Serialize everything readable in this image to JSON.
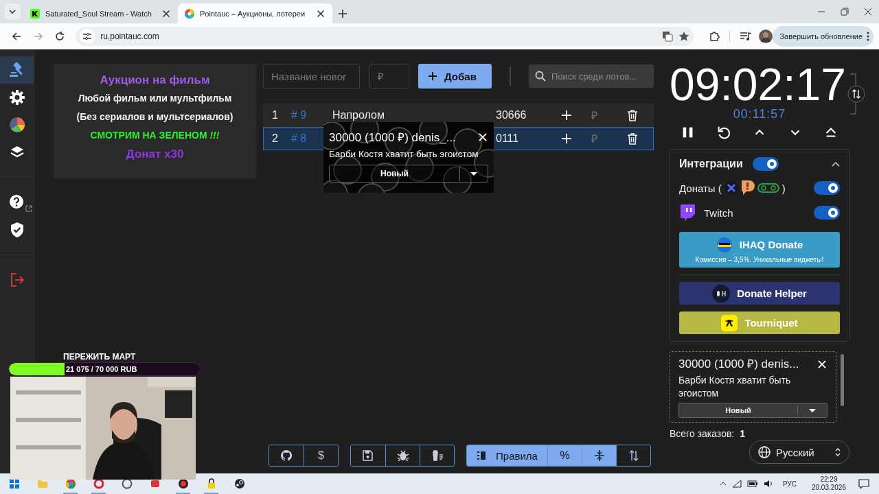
{
  "browser": {
    "tabs": [
      {
        "title": "Saturated_Soul Stream - Watch",
        "selected": false
      },
      {
        "title": "Pointauc – Аукционы, лотереи",
        "selected": true
      }
    ],
    "url": "ru.pointauc.com",
    "update_button": "Завершить обновление"
  },
  "sidebar": {
    "groups": [
      [
        {
          "kind": "auction",
          "selected": true
        },
        {
          "kind": "settings",
          "selected": false
        },
        {
          "kind": "statistics",
          "selected": false
        },
        {
          "kind": "layers",
          "selected": false
        }
      ],
      [
        {
          "kind": "help",
          "selected": false
        },
        {
          "kind": "security",
          "selected": false
        }
      ],
      [
        {
          "kind": "logout",
          "selected": false
        }
      ]
    ]
  },
  "rules": [
    {
      "text": "Аукцион на фильм",
      "kind": "title"
    },
    {
      "text": "Любой фильм или мультфильм",
      "kind": "text"
    },
    {
      "text": "(Без сериалов и мультсериалов)",
      "kind": "text"
    },
    {
      "text": "СМОТРИМ НА ЗЕЛЕНОМ *!!!*",
      "kind": "alert"
    },
    {
      "text": "Донат x30",
      "kind": "accent"
    }
  ],
  "new_lot": {
    "name_placeholder": "Название новог",
    "amount_placeholder": "₽",
    "add_button": "Добав"
  },
  "search": {
    "placeholder": "Поиск среди лотов..."
  },
  "lots": [
    {
      "index": "1",
      "id": "# 9",
      "name": "Напролом",
      "amount": "30666",
      "currency": "₽",
      "selected": false
    },
    {
      "index": "2",
      "id": "# 8",
      "amount": "0111",
      "currency": "₽",
      "selected": true
    }
  ],
  "dragged_donation": {
    "title": "30000 (1000 ₽) denis_...",
    "message": "Барби Костя хватит быть эгоистом",
    "status": "Новый"
  },
  "toolbar": {
    "groups": [
      [
        {
          "kind": "github",
          "selected": false
        },
        {
          "kind": "text",
          "label": "$",
          "selected": false
        }
      ],
      [
        {
          "kind": "save",
          "selected": false
        },
        {
          "kind": "bug",
          "selected": false
        },
        {
          "kind": "clear",
          "selected": false
        }
      ],
      [
        {
          "kind": "rules",
          "label": "Правила",
          "selected": true
        },
        {
          "kind": "text",
          "label": "%",
          "selected": true
        },
        {
          "kind": "compress",
          "selected": true
        },
        {
          "kind": "sort",
          "selected": false
        }
      ]
    ]
  },
  "timer": {
    "time": "09:02:17",
    "elapsed": "00:11:57"
  },
  "integrations": {
    "title": "Интеграции",
    "on": true,
    "expanded": true,
    "donations": {
      "label": "Донаты (",
      "suffix": ")",
      "on": true
    },
    "twitch": {
      "label": "Twitch",
      "on": true
    },
    "services": [
      {
        "kind": "ihaq",
        "name": "IHAQ Donate",
        "subtitle": "Комиссия – 3,5%. Уникальные виджеты!"
      },
      {
        "kind": "donatehelper",
        "name": "Donate Helper"
      },
      {
        "kind": "tourniquet",
        "name": "Tourniquet"
      }
    ]
  },
  "queue": {
    "items": [
      {
        "title": "30000 (1000 ₽) denis...",
        "message": "Барби Костя хватит быть эгоистом",
        "status": "Новый"
      }
    ],
    "total_label": "Всего заказов:",
    "total": "1"
  },
  "language": {
    "value": "Русский"
  },
  "stream_goal": {
    "title": "ПЕРЕЖИТЬ МАРТ",
    "progress": "21 075 / 70 000 RUB",
    "level": 0.29
  },
  "taskbar": {
    "language": "РУС",
    "time": "22:29",
    "date": "20.03.2026"
  }
}
